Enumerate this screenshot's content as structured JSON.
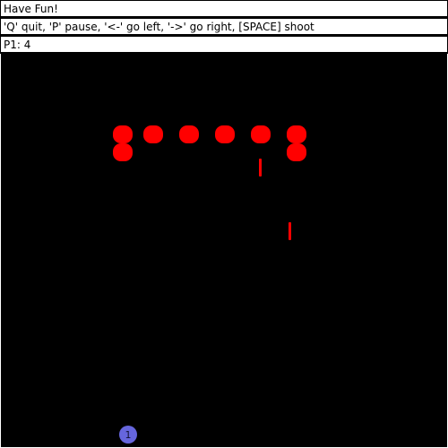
{
  "title": "Have Fun!",
  "controls_hint": "'Q' quit, 'P' pause, '<-' go left, '->' go right, [SPACE] shoot",
  "score": {
    "label": "P1: 4"
  },
  "player": {
    "label": "1",
    "color": "#6666dd"
  },
  "colors": {
    "background": "#000000",
    "invader": "#ff0000",
    "bullet": "#ff0000",
    "bar_background": "#ffffff"
  },
  "game": {
    "invader_count": 8,
    "bullet_count": 2
  }
}
